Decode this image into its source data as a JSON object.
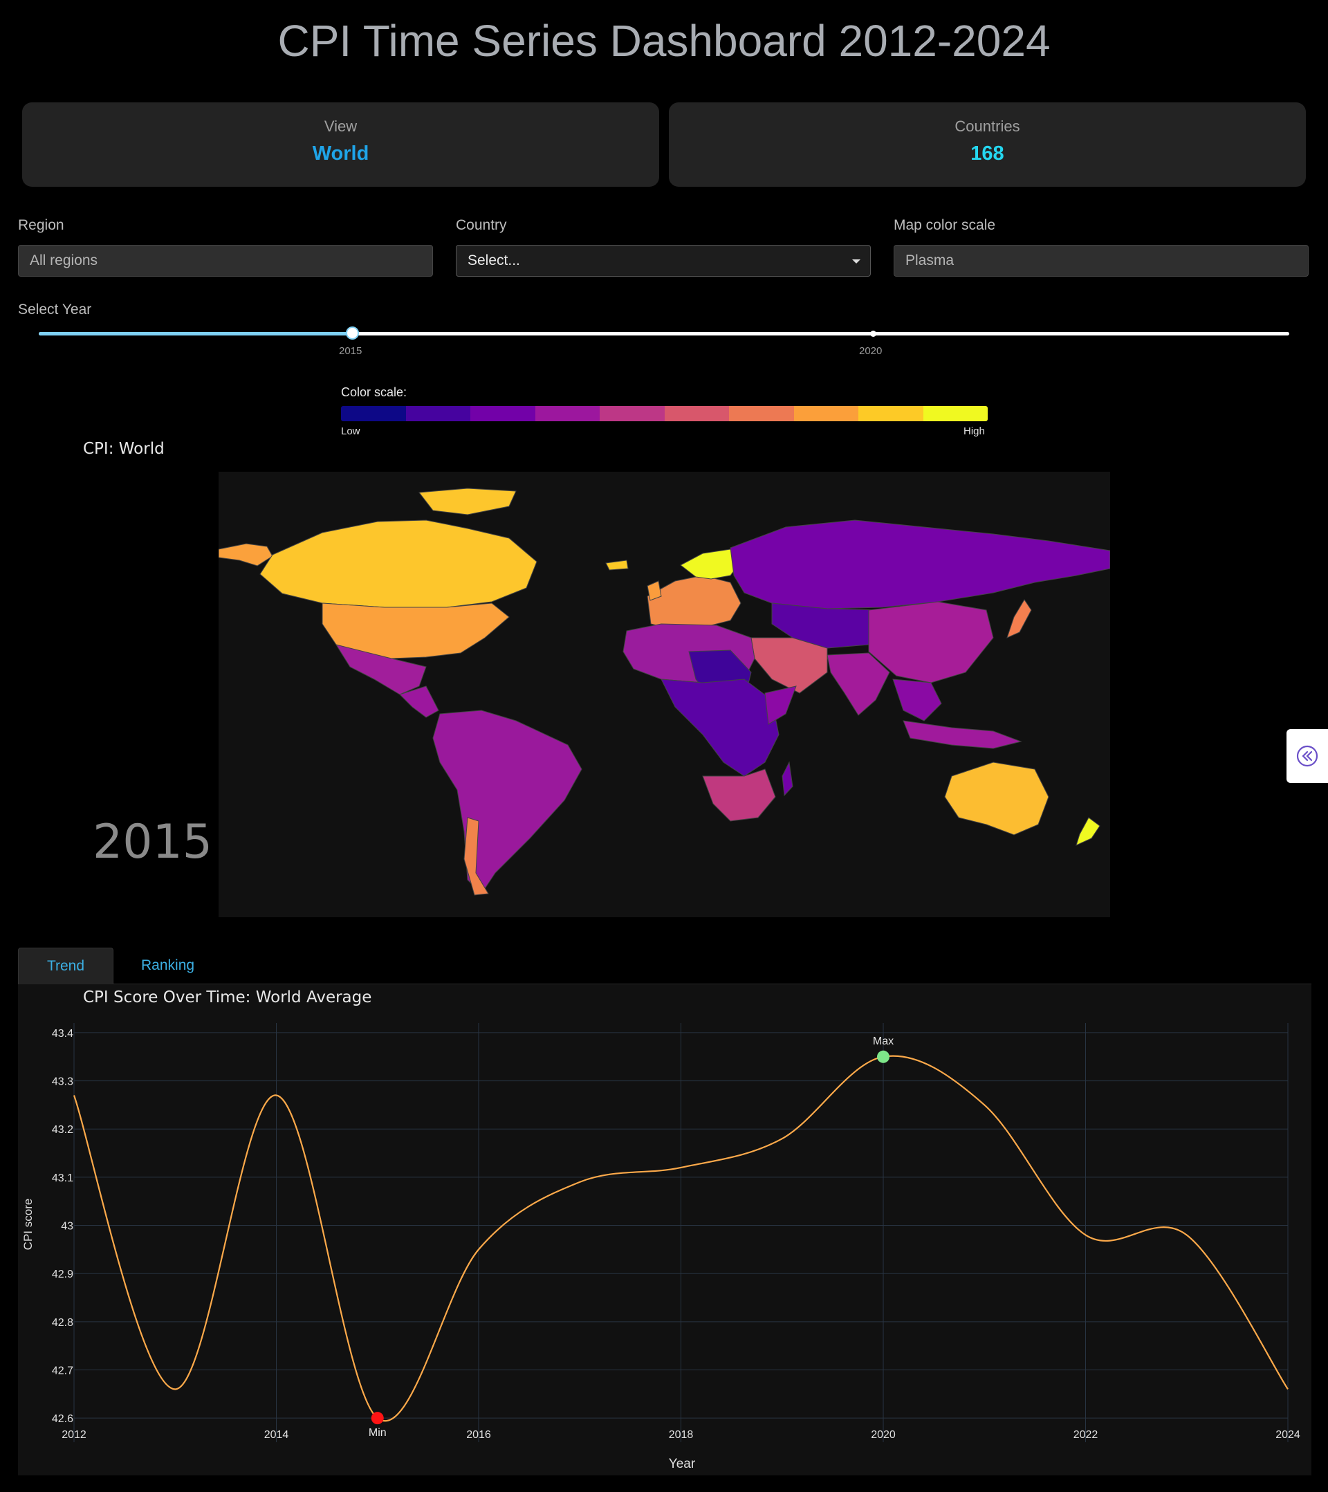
{
  "header": {
    "title": "CPI Time Series Dashboard 2012-2024"
  },
  "cards": [
    {
      "label": "View",
      "value": "World",
      "color": "#1fa4e8"
    },
    {
      "label": "Countries",
      "value": "168",
      "color": "#25d7f0"
    }
  ],
  "filters": {
    "region": {
      "label": "Region",
      "placeholder": "All regions"
    },
    "country": {
      "label": "Country",
      "placeholder": "Select..."
    },
    "colorscale": {
      "label": "Map color scale",
      "value": "Plasma"
    }
  },
  "slider": {
    "label": "Select Year",
    "min": 2012,
    "max": 2024,
    "value": 2015,
    "marks": [
      "2015",
      "2020"
    ]
  },
  "legend": {
    "title": "Color scale:",
    "low": "Low",
    "high": "High",
    "colors": [
      "#0d0887",
      "#46039f",
      "#7201a8",
      "#9c179e",
      "#bd3786",
      "#d8576b",
      "#ed7953",
      "#fb9f3a",
      "#fdca26",
      "#f0f921"
    ]
  },
  "map": {
    "title": "CPI: World",
    "year_label": "2015"
  },
  "tabs": [
    {
      "label": "Trend",
      "active": true
    },
    {
      "label": "Ranking",
      "active": false
    }
  ],
  "chart_data": {
    "type": "line",
    "title": "CPI Score Over Time: World Average",
    "xlabel": "Year",
    "ylabel": "CPI score",
    "x": [
      2012,
      2013,
      2014,
      2015,
      2016,
      2017,
      2018,
      2019,
      2020,
      2021,
      2022,
      2023,
      2024
    ],
    "values": [
      43.27,
      42.66,
      43.27,
      42.6,
      42.95,
      43.09,
      43.12,
      43.18,
      43.35,
      43.25,
      42.98,
      42.98,
      42.66
    ],
    "xlim": [
      2012,
      2024
    ],
    "ylim": [
      42.55,
      43.42
    ],
    "xticks": [
      "2012",
      "2014",
      "2016",
      "2018",
      "2020",
      "2022",
      "2024"
    ],
    "yticks": [
      "42.6",
      "42.7",
      "42.8",
      "42.9",
      "43",
      "43.1",
      "43.2",
      "43.3",
      "43.4"
    ],
    "line_color": "#fca94a",
    "grid": true,
    "annotations": [
      {
        "label": "Max",
        "x": 2020,
        "y": 43.35,
        "color": "#7ee78a"
      },
      {
        "label": "Min",
        "x": 2015,
        "y": 42.6,
        "color": "#ff1414"
      }
    ]
  }
}
